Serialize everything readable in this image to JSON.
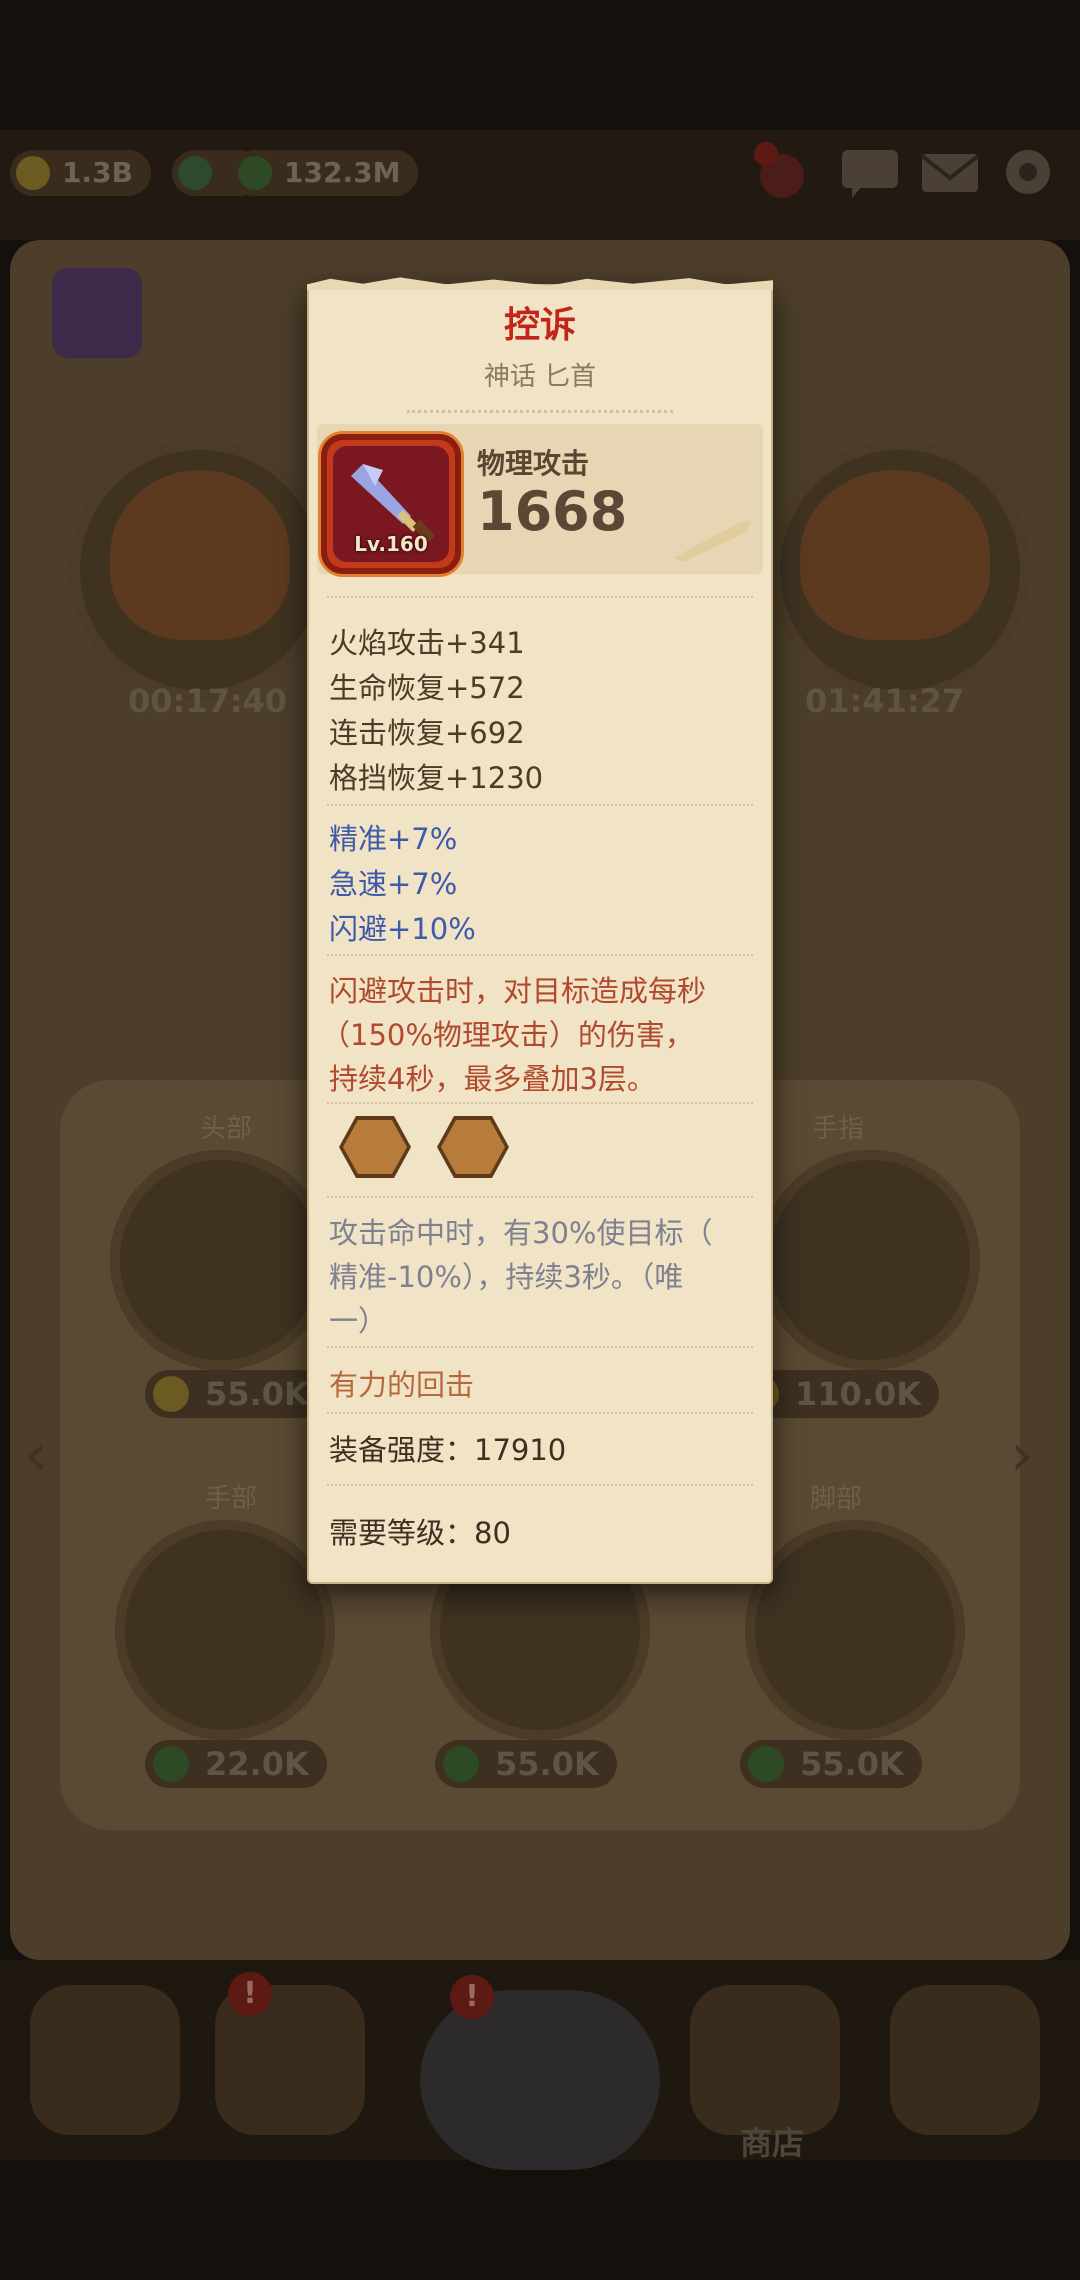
{
  "background": {
    "resources": [
      {
        "icon": "gold-coin-icon",
        "value": "1.3B"
      },
      {
        "icon": "gem-icon",
        "value": ""
      },
      {
        "icon": "leaf-icon",
        "value": "132.3M"
      }
    ],
    "timers": [
      "00:17:40",
      "01:41:27"
    ],
    "slot_labels": {
      "head": "头部",
      "finger": "手指",
      "hand": "手部",
      "foot": "脚部"
    },
    "prices": [
      "55.0K",
      "110.0K",
      "22.0K",
      "55.0K",
      "55.0K"
    ],
    "bottom_nav_label": "商店"
  },
  "tooltip": {
    "title": "控诉",
    "subtitle": "神话 匕首",
    "level_text": "Lv.160",
    "main_stat_label": "物理攻击",
    "main_stat_value": "1668",
    "sub_stats": [
      "火焰攻击+341",
      "生命恢复+572",
      "连击恢复+692",
      "格挡恢复+1230"
    ],
    "blue_stats": [
      "精准+7%",
      "急速+7%",
      "闪避+10%"
    ],
    "passive_lines": [
      "闪避攻击时，对目标造成每秒",
      "（150%物理攻击）的伤害，",
      "持续4秒，最多叠加3层。"
    ],
    "set_effect_lines": [
      "攻击命中时，有30%使目标（",
      "精准-10%），持续3秒。（唯",
      "一）"
    ],
    "set_name": "有力的回击",
    "power_label": "装备强度：17910",
    "required_level_label": "需要等级：80"
  },
  "colors": {
    "title_red": "#c4251b",
    "stat_blue": "#3e5aa8",
    "passive_red": "#b04a2e",
    "card_bg": "#f1e4c6"
  }
}
